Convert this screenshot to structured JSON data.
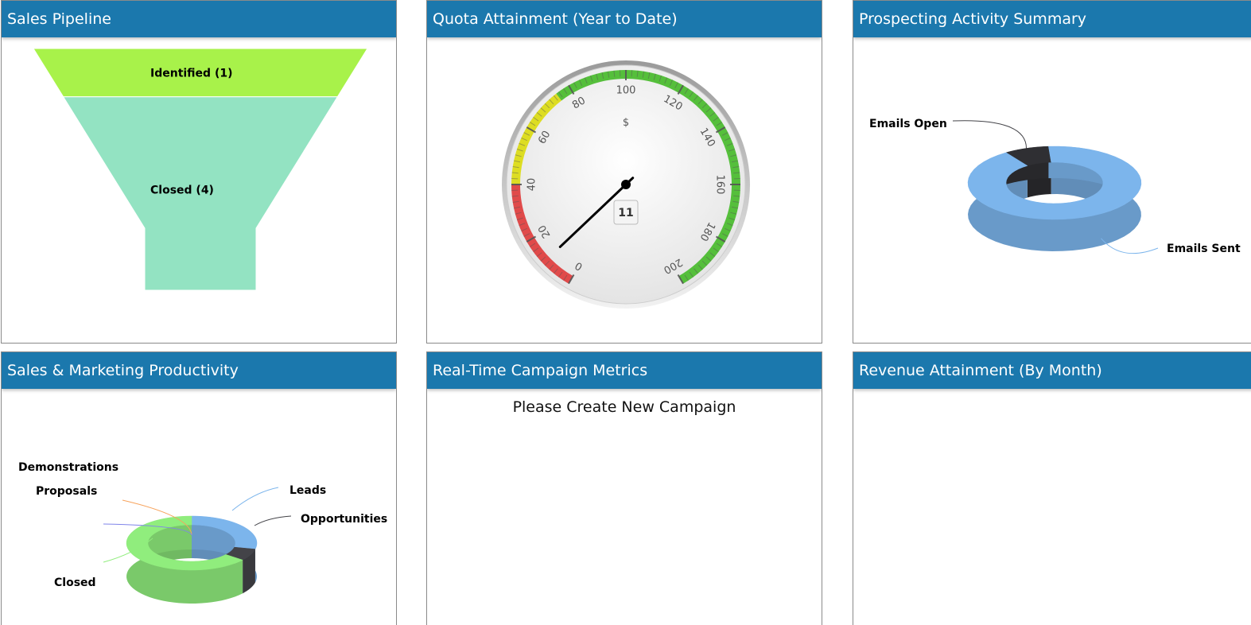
{
  "panels": {
    "sales_pipeline": {
      "title": "Sales Pipeline"
    },
    "quota": {
      "title": "Quota Attainment (Year to Date)"
    },
    "prospecting": {
      "title": "Prospecting Activity Summary"
    },
    "productivity": {
      "title": "Sales & Marketing Productivity"
    },
    "campaign": {
      "title": "Real-Time Campaign Metrics",
      "message": "Please Create New Campaign"
    },
    "revenue": {
      "title": "Revenue Attainment (By Month)"
    }
  },
  "chart_data": [
    {
      "id": "sales_pipeline",
      "type": "funnel",
      "categories": [
        "Identified (1)",
        "Closed (4)"
      ],
      "values": [
        1,
        4
      ],
      "colors": [
        "#a8f24a",
        "#93e3c2"
      ]
    },
    {
      "id": "quota",
      "type": "gauge",
      "value": 11,
      "value_label": "11",
      "unit": "$",
      "range": [
        0,
        200
      ],
      "ticks": [
        "0",
        "20",
        "40",
        "60",
        "80",
        "100",
        "120",
        "140",
        "160",
        "180",
        "200"
      ],
      "bands": [
        {
          "from": 0,
          "to": 40,
          "color": "#e04a4a"
        },
        {
          "from": 40,
          "to": 75,
          "color": "#dddd22"
        },
        {
          "from": 75,
          "to": 200,
          "color": "#55bf3b"
        }
      ]
    },
    {
      "id": "prospecting",
      "type": "pie",
      "categories": [
        "Emails Open",
        "Emails Sent"
      ],
      "values": [
        1,
        11
      ],
      "colors": [
        "#2f2f33",
        "#7cb5ec"
      ]
    },
    {
      "id": "productivity",
      "type": "pie",
      "categories": [
        "Leads",
        "Opportunities",
        "Closed",
        "Demonstrations",
        "Proposals"
      ],
      "values": [
        4,
        1,
        9,
        0,
        0
      ],
      "colors": [
        "#7cb5ec",
        "#434348",
        "#90ed7d",
        "#f7a35c",
        "#8085e9"
      ]
    }
  ]
}
